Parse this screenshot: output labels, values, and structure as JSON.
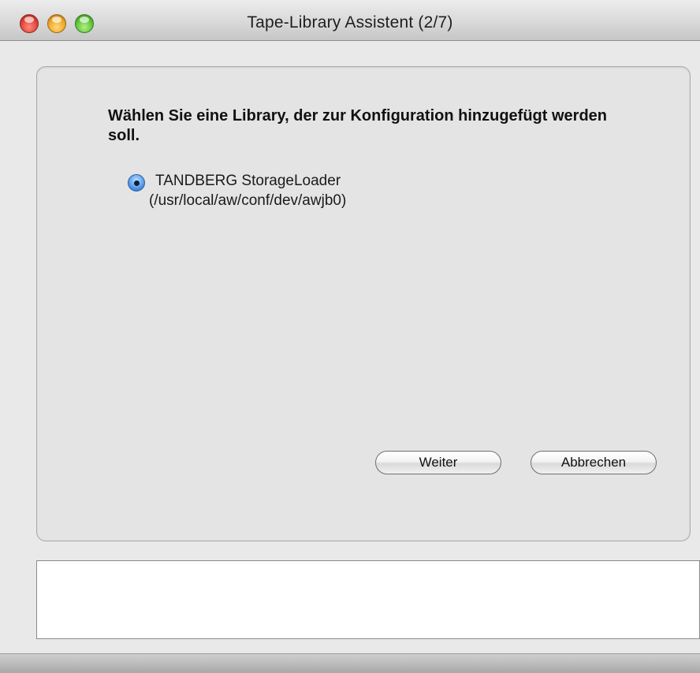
{
  "window": {
    "title": "Tape-Library Assistent (2/7)"
  },
  "main": {
    "heading": "Wählen Sie eine Library, der zur Konfiguration hinzugefügt werden soll.",
    "library_option": {
      "label": "TANDBERG StorageLoader",
      "path": "(/usr/local/aw/conf/dev/awjb0)",
      "selected": true
    },
    "buttons": {
      "next_label": "Weiter",
      "cancel_label": "Abbrechen"
    }
  },
  "log": {
    "text": ""
  },
  "colors": {
    "close": "#e0443a",
    "minimize": "#f0a72a",
    "zoom": "#5ec43a",
    "radio_accent": "#5c9ee8"
  }
}
